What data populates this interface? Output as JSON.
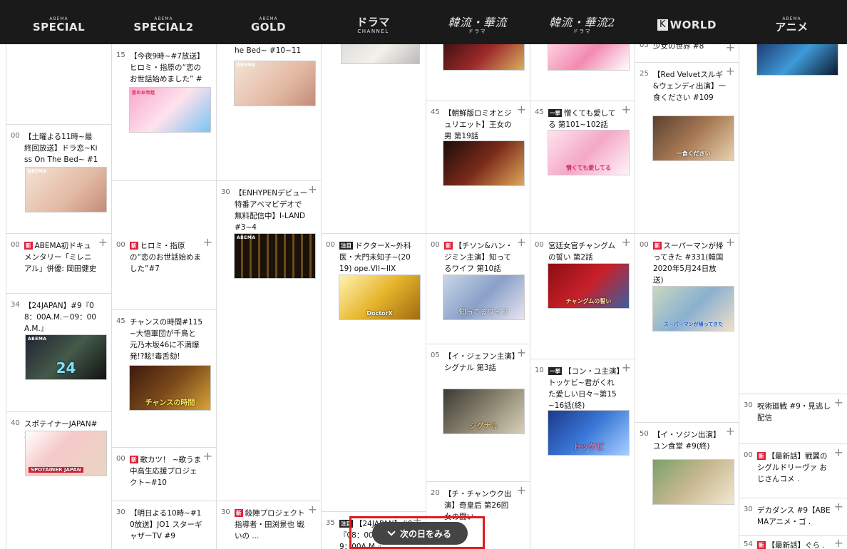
{
  "channels": [
    {
      "sup": "ABEMA",
      "main": "SPECIAL",
      "sub": ""
    },
    {
      "sup": "ABEMA",
      "main": "SPECIAL2",
      "sub": ""
    },
    {
      "sup": "ABEMA",
      "main": "GOLD",
      "sub": ""
    },
    {
      "sup": "",
      "main": "ドラマ",
      "sub": "CHANNEL"
    },
    {
      "sup": "",
      "main": "韓流・華流",
      "sub": "ドラマ"
    },
    {
      "sup": "",
      "main": "韓流・華流2",
      "sub": "ドラマ"
    },
    {
      "sup": "",
      "main": "WORLD",
      "sub": "",
      "box": "K"
    },
    {
      "sup": "ABEMA",
      "main": "アニメ",
      "sub": ""
    }
  ],
  "programs": {
    "c1a": {
      "min": "00",
      "title": "【土曜よる11時~最終回放送】ドラ恋~Kiss On The Bed~ #11",
      "thumb_label": "ABEMA"
    },
    "c1b": {
      "min": "00",
      "badge": "新",
      "title": "ABEMA初ドキュメンタリー「ミレニアル」併優: 岡田健史"
    },
    "c1c": {
      "min": "34",
      "title": "【24JAPAN】#9『08：00A.M.－09：00A.M.』",
      "thumb_label": "ABEMA",
      "thumb_caption": "24"
    },
    "c1d": {
      "min": "40",
      "title": "スポテイナーJAPAN#2",
      "thumb_caption": "SPOTAINER JAPAN"
    },
    "c2a": {
      "min": "15",
      "title": "【今夜9時~#7放送】ヒロミ・指原の“恋のお世話始めました” #5~6",
      "thumb_label": "恋のお世話"
    },
    "c2b": {
      "min": "00",
      "badge": "新",
      "title": "ヒロミ・指原の“恋のお世話始めました”#7"
    },
    "c2c": {
      "min": "45",
      "title": "チャンスの時間#115~大悟軍団が千鳥と元乃木坂46に不満爆発!?眩!毒舌劾!",
      "thumb_caption": "チャンスの時間"
    },
    "c2d": {
      "min": "00",
      "badge": "新",
      "title": "歌カツ！ ~歌うま中高生応援プロジェクト~#10"
    },
    "c2e": {
      "min": "30",
      "title": "【明日よる10時~#10放送】JO1 スターギャザーTV #9"
    },
    "c3a": {
      "title": "he Bed~ #10~11",
      "thumb_label": "ABEMA"
    },
    "c3b": {
      "min": "30",
      "title": "【ENHYPENデビュー特番アベマビデオで無料配信中】I-LAND #3~4",
      "thumb_label": "ABEMA"
    },
    "c3c": {
      "min": "30",
      "badge": "新",
      "title": "殺陣プロジェクト 指導者・田渕景也 戦いの ..."
    },
    "c4a": {
      "min": "00",
      "badge": "注目",
      "title": "ドクターX~外科医・大門未知子~(2019) ope.VII~IIX",
      "thumb_caption": "DoctorX"
    },
    "c4b": {
      "min": "35",
      "badge": "注目",
      "title": "【24JAPAN】#9『08：00A.M.－09：00A.M.』"
    },
    "c5a": {
      "min": "45",
      "title": "【朝鮮版ロミオとジュリエット】王女の男 第19話"
    },
    "c5b": {
      "min": "00",
      "badge": "新",
      "title": "【チソン&ハン・ジミン主演】知ってるワイフ 第10話",
      "thumb_caption": "知ってるワイフ"
    },
    "c5c": {
      "min": "05",
      "title": "【イ・ジェフン主演】シグナル 第3話",
      "thumb_caption": "シグナル"
    },
    "c5d": {
      "min": "20",
      "title": "【チ・チャンウク出演】奇皇后 第26回 女の闘い"
    },
    "c6a": {
      "min": "45",
      "badge": "一挙",
      "title": "憎くても愛してる 第101~102話",
      "thumb_caption": "憎くても愛してる"
    },
    "c6b": {
      "min": "00",
      "title": "宮廷女官チャングムの誓い 第2話",
      "thumb_caption": "チャングムの誓い"
    },
    "c6c": {
      "min": "10",
      "badge": "一挙",
      "title": "【コン・ユ主演】トッケビ~君がくれた愛しい日々~第15~16話(終)",
      "thumb_caption": "トッケビ"
    },
    "c7a": {
      "min": "05",
      "title": "少女の世界 #8"
    },
    "c7b": {
      "min": "25",
      "title": "【Red Velvetスルギ&ウェンディ出演】一食ください #109",
      "thumb_caption": "一食ください"
    },
    "c7c": {
      "min": "00",
      "badge": "新",
      "title": "スーパーマンが帰ってきた #331(韓国2020年5月24日放送)",
      "thumb_caption": "スーパーマンが帰ってきた"
    },
    "c7d": {
      "min": "50",
      "title": "【イ・ソジン出演】ユン食堂 #9(終)"
    },
    "c8a": {
      "min": "30",
      "title": "呪術廻戦 #9・見逃し配信"
    },
    "c8b": {
      "min": "00",
      "badge": "新",
      "title": "【最新話】戦翼のシグルドリーヴァ おじさんコメ ."
    },
    "c8c": {
      "min": "30",
      "title": "デカダンス #9【ABEMAアニメ・ゴ ."
    },
    "c8d": {
      "min": "54",
      "badge": "新",
      "title": "【最新話】ぐら ."
    }
  },
  "next_day_button": "次の日をみる",
  "add_icon": "+"
}
